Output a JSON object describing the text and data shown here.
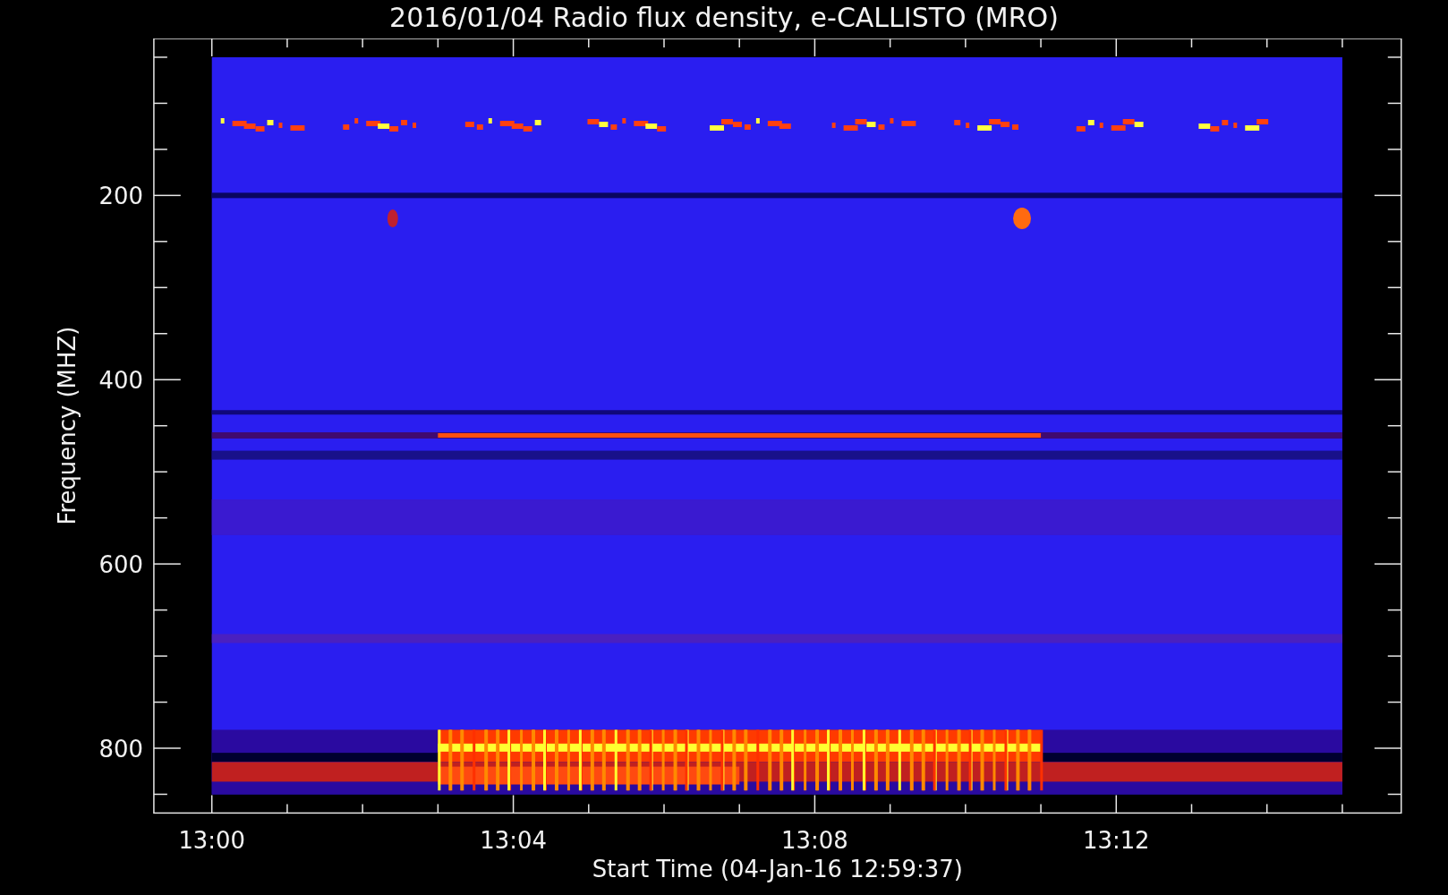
{
  "title": "2016/01/04  Radio flux density, e-CALLISTO (MRO)",
  "plot": {
    "xlabel": "Start Time (04-Jan-16 12:59:37)",
    "ylabel": "Frequency (MHZ)",
    "xtick_labels": [
      "13:00",
      "13:04",
      "13:08",
      "13:12"
    ],
    "ytick_labels": [
      "200",
      "400",
      "600",
      "800"
    ]
  }
}
